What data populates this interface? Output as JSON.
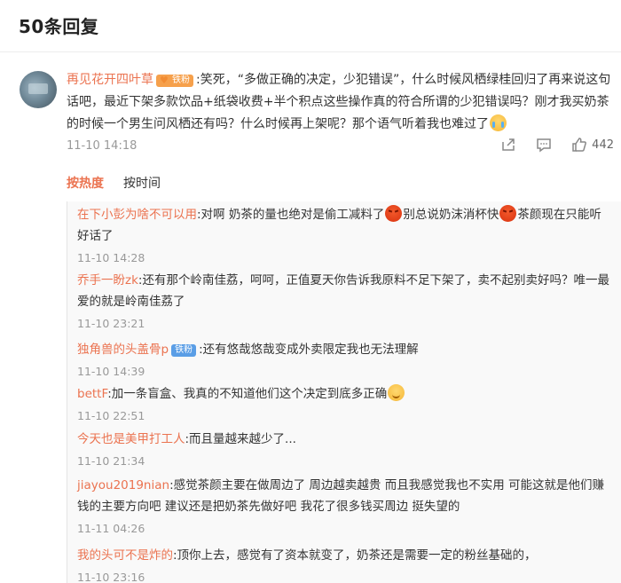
{
  "header": {
    "title": "50条回复"
  },
  "main_comment": {
    "username": "再见花开四叶草",
    "fan_badge": "铁粉",
    "text": ":笑死，“多做正确的决定，少犯错误”，什么时候风栖绿桂回归了再来说这句话吧，最近下架多款饮品+纸袋收费+半个积点这些操作真的符合所谓的少犯错误吗？刚才我买奶茶的时候一个男生问风栖还有吗？什么时候再上架呢？那个语气听着我也难过了",
    "time": "11-10 14:18",
    "likes": "442"
  },
  "sort": {
    "hot": "按热度",
    "time": "按时间"
  },
  "replies": [
    {
      "username": "在下小彭为啥不可以用",
      "text_a": ":对啊 奶茶的量也绝对是偷工减料了",
      "text_b": "别总说奶沫消杯快",
      "text_c": "茶颜现在只能听好话了",
      "time": "11-10 14:28"
    },
    {
      "username": "乔手一盼zk",
      "text": ":还有那个岭南佳荔，呵呵，正值夏天你告诉我原料不足下架了，卖不起别卖好吗？唯一最爱的就是岭南佳荔了",
      "time": "11-10 23:21"
    },
    {
      "username": "独角兽的头盖骨p",
      "fan_badge": "铁粉",
      "text": ":还有悠哉悠哉变成外卖限定我也无法理解",
      "time": "11-10 14:39"
    },
    {
      "username": "bettF",
      "text": ":加一条盲盒、我真的不知道他们这个决定到底多正确",
      "time": "11-10 22:51"
    },
    {
      "username": "今天也是美甲打工人",
      "text": ":而且量越来越少了...",
      "time": "11-10 21:34"
    },
    {
      "username": "jiayou2019nian",
      "text": ":感觉茶颜主要在做周边了 周边越卖越贵 而且我感觉我也不实用 可能这就是他们赚钱的主要方向吧 建议还是把奶茶先做好吧 我花了很多钱买周边 挺失望的",
      "time": "11-11 04:26"
    },
    {
      "username": "我的头可不是炸的",
      "text": ":顶你上去，感觉有了资本就变了，奶茶还是需要一定的粉丝基础的，",
      "time": "11-10 23:16"
    }
  ]
}
